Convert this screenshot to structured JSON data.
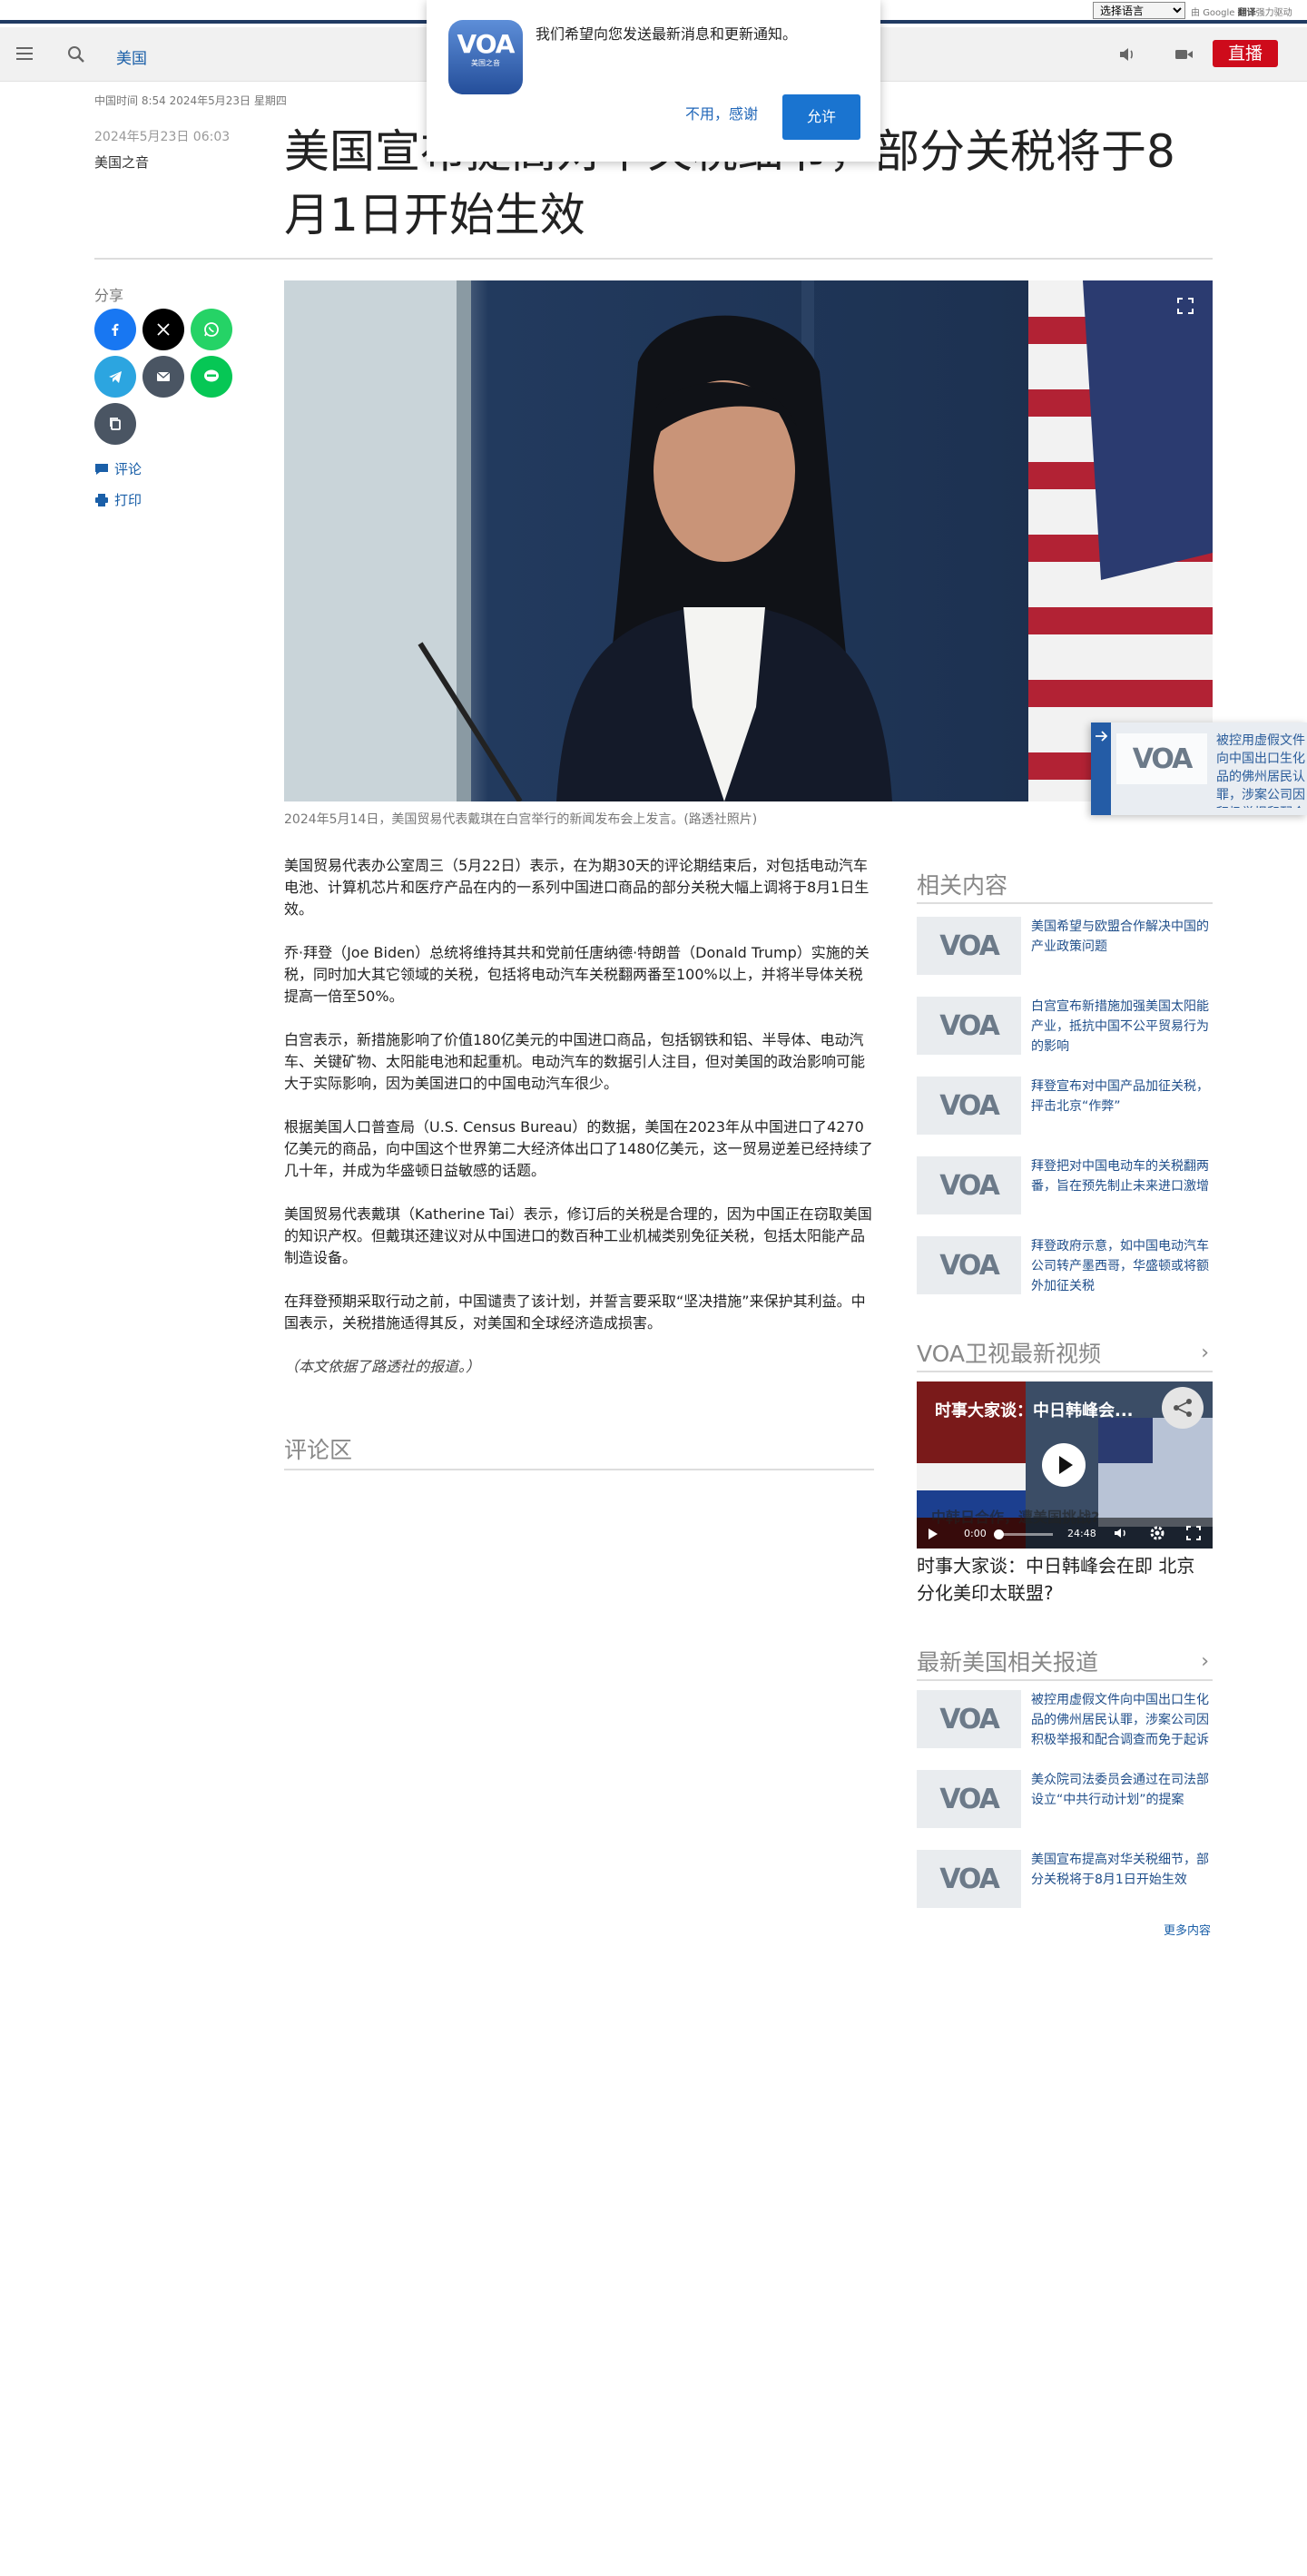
{
  "translate_bar": {
    "select_value": "选择语言",
    "powered_prefix": "由",
    "powered_google": "Google",
    "powered_translate": "翻译",
    "powered_suffix": "强力驱动"
  },
  "nav": {
    "section": "美国",
    "live_label": "直播"
  },
  "dateline": "中国时间 8:54 2024年5月23日 星期四",
  "notification": {
    "logo_text": "VOA",
    "logo_sub": "美国之音",
    "message": "我们希望向您发送最新消息和更新通知。",
    "decline_label": "不用，感谢",
    "allow_label": "允许"
  },
  "article": {
    "published": "2024年5月23日 06:03",
    "author": "美国之音",
    "headline": "美国宣布提高对华关税细节，部分关税将于8月1日开始生效",
    "image_caption": "2024年5月14日，美国贸易代表戴琪在白宫举行的新闻发布会上发言。(路透社照片)",
    "paragraphs": [
      "美国贸易代表办公室周三（5月22日）表示，在为期30天的评论期结束后，对包括电动汽车电池、计算机芯片和医疗产品在内的一系列中国进口商品的部分关税大幅上调将于8月1日生效。",
      "乔·拜登（Joe Biden）总统将维持其共和党前任唐纳德·特朗普（Donald Trump）实施的关税，同时加大其它领域的关税，包括将电动汽车关税翻两番至100%以上，并将半导体关税提高一倍至50%。",
      "白宫表示，新措施影响了价值180亿美元的中国进口商品，包括钢铁和铝、半导体、电动汽车、关键矿物、太阳能电池和起重机。电动汽车的数据引人注目，但对美国的政治影响可能大于实际影响，因为美国进口的中国电动汽车很少。",
      "根据美国人口普查局（U.S. Census Bureau）的数据，美国在2023年从中国进口了4270亿美元的商品，向中国这个世界第二大经济体出口了1480亿美元，这一贸易逆差已经持续了几十年，并成为华盛顿日益敏感的话题。",
      "美国贸易代表戴琪（Katherine Tai）表示，修订后的关税是合理的，因为中国正在窃取美国的知识产权。但戴琪还建议对从中国进口的数百种工业机械类别免征关税，包括太阳能产品制造设备。",
      "在拜登预期采取行动之前，中国谴责了该计划，并誓言要采取“坚决措施”来保护其利益。中国表示，关税措施适得其反，对美国和全球经济造成损害。"
    ],
    "credit": "（本文依据了路透社的报道。）",
    "comments_heading": "评论区"
  },
  "share": {
    "label": "分享",
    "comment_label": "评论",
    "print_label": "打印"
  },
  "float_card": {
    "logo": "VOA",
    "text": "被控用虚假文件向中国出口生化品的佛州居民认罪，涉案公司因积极举报和配合调查而免于起诉"
  },
  "related": {
    "heading": "相关内容",
    "items": [
      {
        "logo": "VOA",
        "title": "美国希望与欧盟合作解决中国的产业政策问题"
      },
      {
        "logo": "VOA",
        "title": "白宫宣布新措施加强美国太阳能产业，抵抗中国不公平贸易行为的影响"
      },
      {
        "logo": "VOA",
        "title": "拜登宣布对中国产品加征关税，抨击北京“作弊”"
      },
      {
        "logo": "VOA",
        "title": "拜登把对中国电动车的关税翻两番，旨在预先制止未来进口激增"
      },
      {
        "logo": "VOA",
        "title": "拜登政府示意，如中国电动汽车公司转产墨西哥，华盛顿或将额外加征关税"
      }
    ]
  },
  "video_section": {
    "heading": "VOA卫视最新视频",
    "overlay_title": "时事大家谈：中日韩峰会...",
    "overlay_sub": "中韩日合作，遭美国挑战?",
    "time_current": "0:00",
    "time_total": "24:48",
    "title": "时事大家谈：中日韩峰会在即 北京分化美印太联盟?"
  },
  "latest_us": {
    "heading": "最新美国相关报道",
    "items": [
      {
        "logo": "VOA",
        "title": "被控用虚假文件向中国出口生化品的佛州居民认罪，涉案公司因积极举报和配合调查而免于起诉"
      },
      {
        "logo": "VOA",
        "title": "美众院司法委员会通过在司法部设立“中共行动计划”的提案"
      },
      {
        "logo": "VOA",
        "title": "美国宣布提高对华关税细节，部分关税将于8月1日开始生效"
      }
    ],
    "more_label": "更多内容"
  },
  "colors": {
    "brand_blue": "#1a5fa8",
    "live_red": "#ce0b1b",
    "allow_blue": "#1a74d0"
  }
}
